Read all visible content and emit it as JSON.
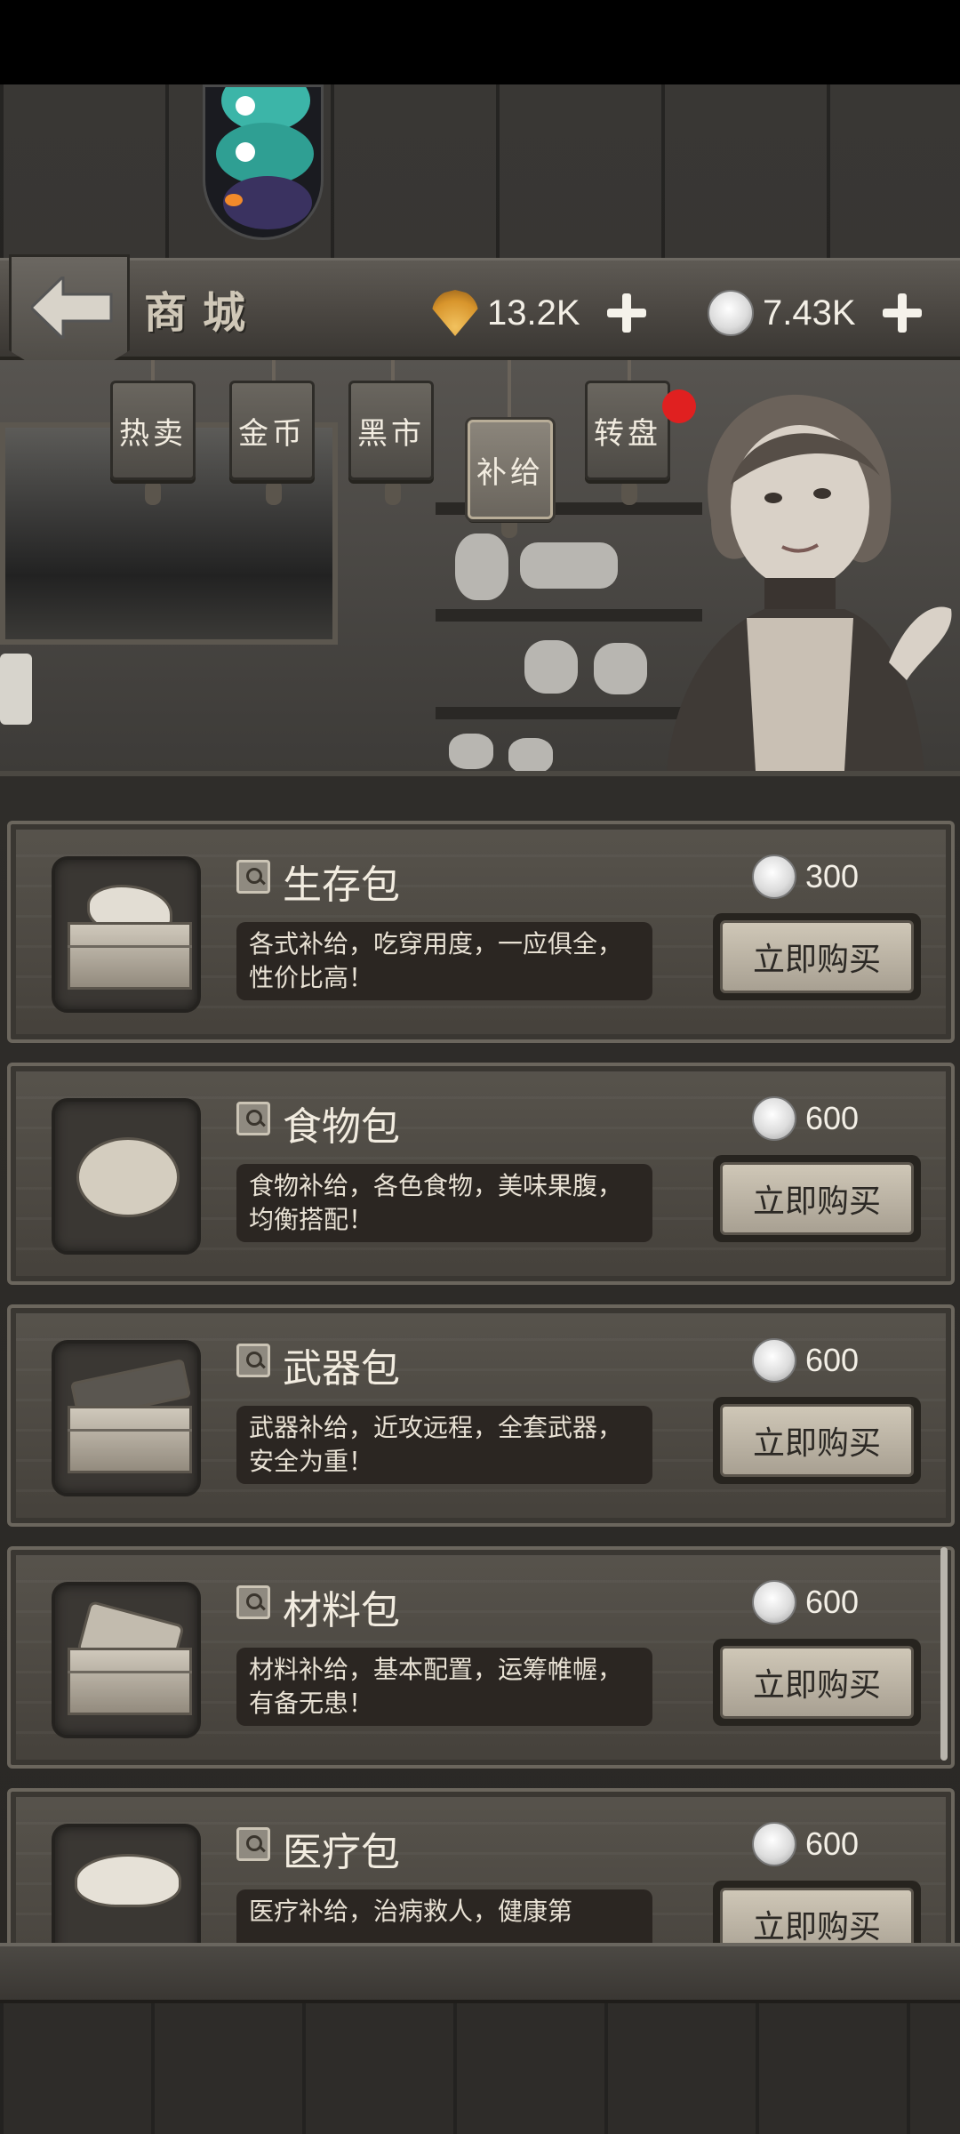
{
  "header": {
    "title": "商城",
    "shells": "13.2K",
    "coins": "7.43K"
  },
  "tabs": [
    {
      "label": "热卖",
      "active": false
    },
    {
      "label": "金币",
      "active": false
    },
    {
      "label": "黑市",
      "active": false
    },
    {
      "label": "补给",
      "active": true
    },
    {
      "label": "转盘",
      "active": false,
      "badge": true
    }
  ],
  "items": [
    {
      "name": "生存包",
      "desc": "各式补给，吃穿用度，一应俱全，性价比高！",
      "price": "300",
      "buy_label": "立即购买"
    },
    {
      "name": "食物包",
      "desc": "食物补给，各色食物，美味果腹，均衡搭配！",
      "price": "600",
      "buy_label": "立即购买"
    },
    {
      "name": "武器包",
      "desc": "武器补给，近攻远程，全套武器，安全为重！",
      "price": "600",
      "buy_label": "立即购买"
    },
    {
      "name": "材料包",
      "desc": "材料补给，基本配置，运筹帷幄，有备无患！",
      "price": "600",
      "buy_label": "立即购买"
    },
    {
      "name": "医疗包",
      "desc": "医疗补给，治病救人，健康第",
      "price": "600",
      "buy_label": "立即购买"
    }
  ],
  "colors": {
    "wood_dark": "#2f2d2a",
    "wood_card": "#57534c",
    "button_face": "#cfc7b7",
    "badge_red": "#e02020"
  },
  "icons": [
    "back-arrow-icon",
    "shell-icon",
    "coin-icon",
    "plus-icon",
    "magnifier-icon"
  ]
}
